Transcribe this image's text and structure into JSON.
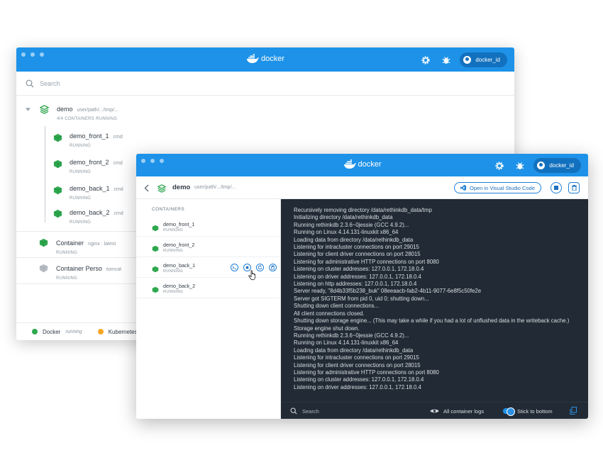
{
  "back_window": {
    "brand": "docker",
    "user_label": "docker_id",
    "search_placeholder": "Search",
    "app": {
      "name": "demo",
      "path": "user/path/.../tmp/...",
      "status": "4/4 CONTAINERS RUNNING"
    },
    "services": [
      {
        "name": "demo_front_1",
        "tag": "cmd",
        "status": "RUNNING"
      },
      {
        "name": "demo_front_2",
        "tag": "cmd",
        "status": "RUNNING"
      },
      {
        "name": "demo_back_1",
        "tag": "cmd",
        "status": "RUNNING"
      },
      {
        "name": "demo_back_2",
        "tag": "cmd",
        "status": "RUNNING"
      }
    ],
    "containers": [
      {
        "name": "Container",
        "tag": "nginx : latest",
        "status": "RUNNING",
        "color": "#2fa84f"
      },
      {
        "name": "Container Perso",
        "tag": "tomcat",
        "status": "RUNNING",
        "color": "#b8bec4"
      }
    ],
    "status_bar": {
      "docker_label": "Docker",
      "docker_state": "running",
      "kubernetes_label": "Kubernetes",
      "docker_color": "#2fa84f",
      "kubernetes_color": "#f5a623"
    }
  },
  "front_window": {
    "brand": "docker",
    "user_label": "docker_id",
    "app_name": "demo",
    "app_path": "user/path/.../tmp/...",
    "open_vscode_label": "Open in Visual Studio Code",
    "containers_heading": "CONTAINERS",
    "containers": [
      {
        "name": "demo_front_1",
        "status": "RUNNING"
      },
      {
        "name": "demo_front_2",
        "status": "RUNNING"
      },
      {
        "name": "demo_back_1",
        "status": "RUNNING"
      },
      {
        "name": "demo_back_2",
        "status": "RUNNING"
      }
    ],
    "logs": [
      "Recursively removing directory /data/rethinkdb_data/tmp",
      "Initializing directory /data/rethinkdb_data",
      "Running rethinkdb 2.3.6~0jessie (GCC 4.9.2)...",
      "Running on Linux 4.14.131-linuxkit x86_64",
      "Loading data from directory /data/rethinkdb_data",
      "Listening for intracluster connections on port 29015",
      "Listening for client driver connections on port 28015",
      "Listening for administrative HTTP connections on port 8080",
      "Listening on cluster addresses: 127.0.0.1, 172.18.0.4",
      "Listening on driver addresses: 127.0.0.1, 172.18.0.4",
      "Listening on http addresses: 127.0.0.1, 172.18.0.4",
      "Server ready, \"8d4b33f5b238_buk\" 08eeaacb-fab2-4b11-9077-6e8f5c50fe2e",
      "Server got SIGTERM from pid 0, uid 0; shutting down...",
      "Shutting down client connections...",
      "All client connections closed.",
      "Shutting down storage engine... (This may take a while if you had a lot of unflushed data in the writeback cache.)",
      "Storage engine shut down.",
      "Running rethinkdb 2.3.6~0jessie (GCC 4.9.2)...",
      "Running on Linux 4.14.131-linuxkit x86_64",
      "Loading data from directory /data/rethinkdb_data",
      "Listening for intracluster connections on port 29015",
      "Listening for client driver connections on port 28015",
      "Listening for administrative HTTP connections on port 8080",
      "Listening on cluster addresses: 127.0.0.1, 172.18.0.4",
      "Listening on driver addresses: 127.0.0.1, 172.18.0.4"
    ],
    "bottom_bar": {
      "search_placeholder": "Search",
      "all_logs_label": "All container logs",
      "stick_label": "Stick to bottom"
    }
  },
  "colors": {
    "docker_blue": "#1d92e8",
    "running_green": "#2fa84f",
    "log_background": "#222b35"
  }
}
